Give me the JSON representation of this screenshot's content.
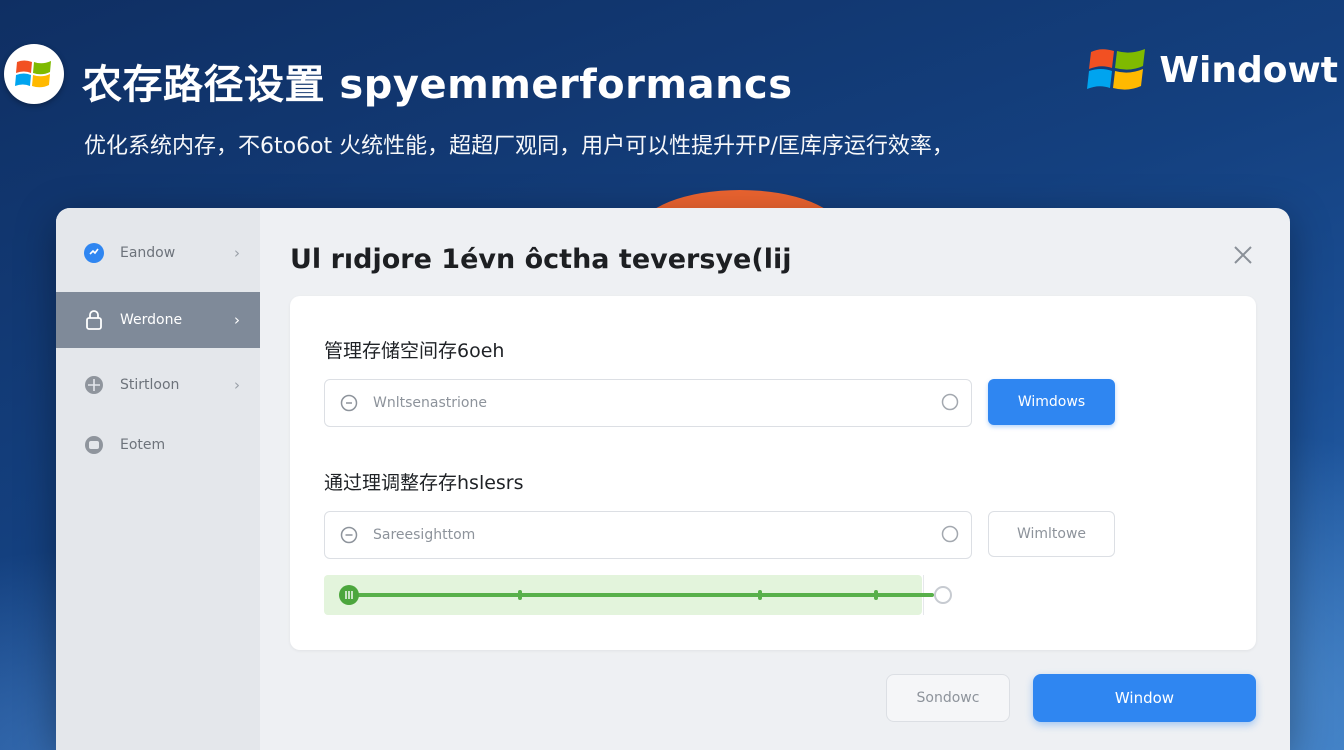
{
  "header": {
    "title": "农存路径设置 spуemmerformancs",
    "brand": "Windowt",
    "subtitle": "优化系统内存，不6to6ot 火统性能，超超厂观同，用户可以性提升开P/匡库序运行效率，"
  },
  "colors": {
    "accent": "#2f86f1",
    "sidebar_active": "#7f8a99",
    "slider_green": "#58b04a",
    "orange": "#ec6430"
  },
  "sidebar": {
    "items": [
      {
        "label": "Eandow",
        "icon": "blue-circle-icon",
        "chevron": "›"
      },
      {
        "label": "Werdone",
        "icon": "lock-icon",
        "chevron": "›"
      },
      {
        "label": "Stirtloon",
        "icon": "circle-plus-icon",
        "chevron": "›"
      },
      {
        "label": "Eotem",
        "icon": "circle-square-icon"
      }
    ]
  },
  "dialog": {
    "title": "Ul rıdjore 1évn ôсtha teversye(lij",
    "close_icon": "close-icon"
  },
  "section1": {
    "label": "管理存储空间存6oeh",
    "field_placeholder": "Wnltsenastrione",
    "button": "Wimdows"
  },
  "section2": {
    "label": "通过理调整存存hslesrs",
    "field_placeholder": "Sareesighttom",
    "button": "Wimltowe"
  },
  "slider": {
    "value": 1.0,
    "ticks": 4
  },
  "footer": {
    "cancel": "Sondowc",
    "ok": "Window"
  }
}
